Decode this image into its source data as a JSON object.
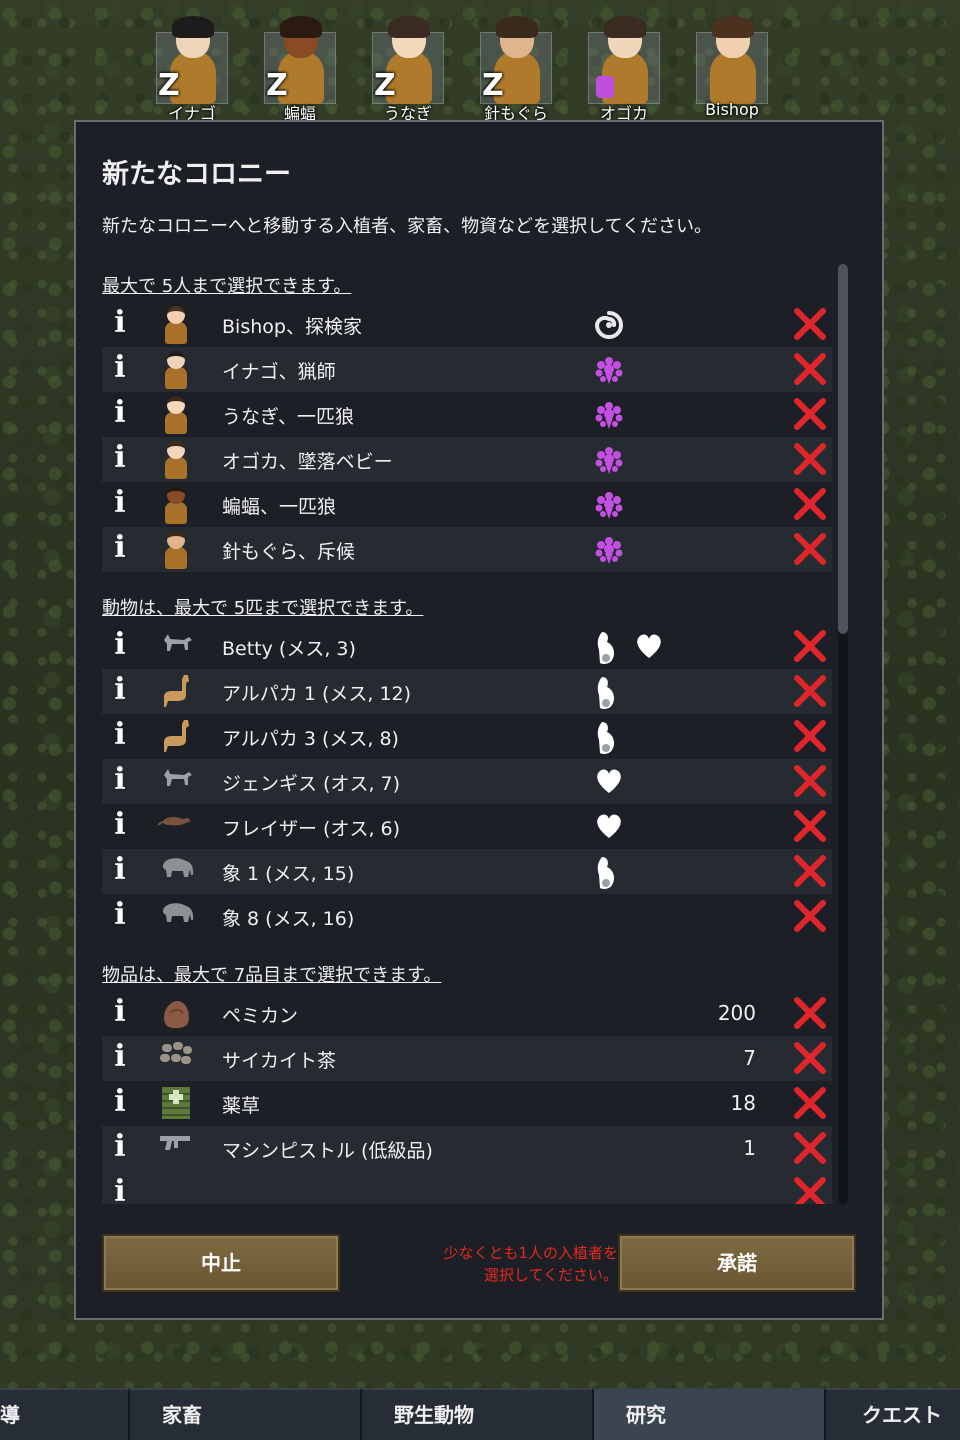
{
  "colonist_bar": [
    {
      "name": "イナゴ",
      "sleeping": true,
      "skin": "#f0d4b8",
      "hair": "#1c1c1c"
    },
    {
      "name": "蝙蝠",
      "sleeping": true,
      "skin": "#8a4a24",
      "hair": "#2a1a10"
    },
    {
      "name": "うなぎ",
      "sleeping": true,
      "skin": "#f4d8bc",
      "hair": "#3a2c20"
    },
    {
      "name": "針もぐら",
      "sleeping": true,
      "skin": "#e0b48c",
      "hair": "#3a2a1c"
    },
    {
      "name": "オゴカ",
      "sleeping": false,
      "mental": true,
      "skin": "#f2d6ba",
      "hair": "#3a2c20"
    },
    {
      "name": "Bishop",
      "sleeping": false,
      "skin": "#f0cfae",
      "hair": "#4a321e"
    }
  ],
  "dialog": {
    "title": "新たなコロニー",
    "description": "新たなコロニーへと移動する入植者、家畜、物資などを選択してください。",
    "colonists_header": "最大で 5人まで選択できます。",
    "colonists": [
      {
        "label": "Bishop、探検家",
        "trait": "swirl",
        "skin": "#f0cfae",
        "hair": "#4a321e"
      },
      {
        "label": "イナゴ、猟師",
        "trait": "flower",
        "skin": "#f0d4b8",
        "hair": "#1c1c1c"
      },
      {
        "label": "うなぎ、一匹狼",
        "trait": "flower",
        "skin": "#f4d8bc",
        "hair": "#3a2c20"
      },
      {
        "label": "オゴカ、墜落ベビー",
        "trait": "flower",
        "skin": "#f2d6ba",
        "hair": "#3a2c20"
      },
      {
        "label": "蝙蝠、一匹狼",
        "trait": "flower",
        "skin": "#8a4a24",
        "hair": "#2a1a10"
      },
      {
        "label": "針もぐら、斥候",
        "trait": "flower",
        "skin": "#e0b48c",
        "hair": "#3a2a1c"
      }
    ],
    "animals_header": "動物は、最大で 5匹まで選択できます。",
    "animals": [
      {
        "label": "Betty (メス, 3)",
        "kind": "dog",
        "pregnant": true,
        "bonded": true
      },
      {
        "label": "アルパカ 1 (メス, 12)",
        "kind": "alpaca",
        "pregnant": true,
        "bonded": false
      },
      {
        "label": "アルパカ 3 (メス, 8)",
        "kind": "alpaca",
        "pregnant": true,
        "bonded": false
      },
      {
        "label": "ジェンギス (オス, 7)",
        "kind": "dog",
        "pregnant": false,
        "bonded": true
      },
      {
        "label": "フレイザー (オス, 6)",
        "kind": "rat",
        "pregnant": false,
        "bonded": true
      },
      {
        "label": "象 1 (メス, 15)",
        "kind": "elephant",
        "pregnant": true,
        "bonded": false
      },
      {
        "label": "象 8 (メス, 16)",
        "kind": "elephant",
        "pregnant": false,
        "bonded": false
      }
    ],
    "items_header": "物品は、最大で 7品目まで選択できます。",
    "items": [
      {
        "label": "ペミカン",
        "qty": "200",
        "kind": "pemmican"
      },
      {
        "label": "サイカイト茶",
        "qty": "7",
        "kind": "tea"
      },
      {
        "label": "薬草",
        "qty": "18",
        "kind": "herbal"
      },
      {
        "label": "マシンピストル (低級品)",
        "qty": "1",
        "kind": "pistol"
      }
    ],
    "cancel_label": "中止",
    "accept_label": "承諾",
    "warning_line1": "少なくとも1人の入植者を",
    "warning_line2": "選択してください。"
  },
  "tabs": [
    {
      "label": "導",
      "active": false
    },
    {
      "label": "家畜",
      "active": false
    },
    {
      "label": "野生動物",
      "active": false
    },
    {
      "label": "研究",
      "active": true
    },
    {
      "label": "クエスト",
      "active": false
    }
  ],
  "colors": {
    "remove_red": "#e0262a",
    "trait_purple": "#c44fe3",
    "panel_bg": "#1c2026",
    "button_brown": "#7e6a42"
  }
}
